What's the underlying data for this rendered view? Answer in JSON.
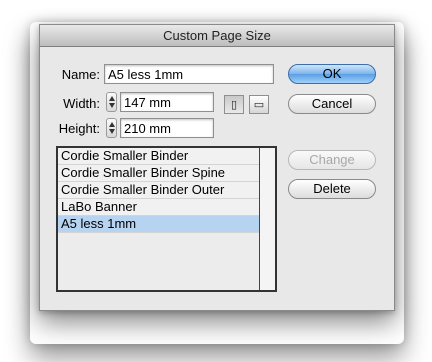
{
  "dialog": {
    "title": "Custom Page Size",
    "name_label": "Name:",
    "name_value": "A5 less 1mm",
    "width_label": "Width:",
    "width_value": "147 mm",
    "height_label": "Height:",
    "height_value": "210 mm",
    "orientation": {
      "portrait_icon": "portrait-page-icon",
      "landscape_icon": "landscape-page-icon",
      "selected": "portrait"
    },
    "buttons": {
      "ok": "OK",
      "cancel": "Cancel",
      "change": "Change",
      "delete": "Delete"
    },
    "presets": [
      {
        "label": "Cordie Smaller Binder"
      },
      {
        "label": "Cordie Smaller Binder Spine"
      },
      {
        "label": "Cordie Smaller Binder Outer"
      },
      {
        "label": "LaBo Banner"
      },
      {
        "label": "A5 less 1mm"
      }
    ],
    "selected_preset": "A5 less 1mm"
  },
  "colors": {
    "dialog_bg": "#e8e8e8",
    "default_button": "#7db4ec",
    "selection": "#b6d3f1"
  }
}
